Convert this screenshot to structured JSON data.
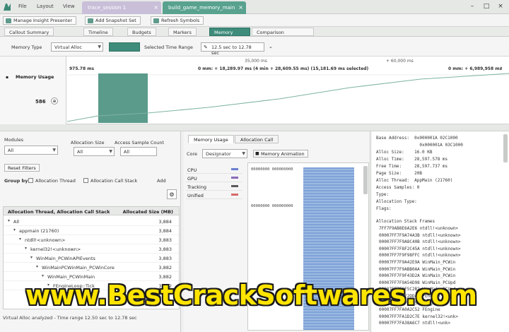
{
  "titlebar": {
    "menu": [
      "File",
      "Layout",
      "View"
    ],
    "tabs": [
      {
        "label": "trace_session 1",
        "active": false
      },
      {
        "label": "build_game_memory_main",
        "active": true
      }
    ]
  },
  "toolbar": {
    "buttons": [
      "Manage Insight Presenter",
      "Add Snapshot Set",
      "Refresh Symbols"
    ]
  },
  "view_tabs": [
    "Callout Summary",
    "Timeline",
    "Budgets",
    "Markers",
    "Memory",
    "Comparison"
  ],
  "filterbar": {
    "memory_type_label": "Memory Type",
    "memory_type_value": "Virtual Alloc",
    "selected_range_label": "Selected Time Range",
    "selected_range_value": "12.5 sec to 12.78 sec"
  },
  "timeline": {
    "track_label": "Memory Usage",
    "ruler_left": "975.78 ms",
    "ruler_mid": "35,000 ms",
    "ruler_right": "+ 60,000 ms",
    "summary_a": "0 mm: + 18,289.97 ms (4 min + 28,609.55 ms) (15,181.69 ms selected)",
    "summary_b": "0 mm: + 6,989,958 ms",
    "y_value": "586"
  },
  "left": {
    "module_label": "Modules",
    "module_value": "All",
    "callstack_label": "Allocation Size",
    "callstack_value": "All",
    "sample_label": "Access Sample Count",
    "sample_value": "All",
    "reset_label": "Reset Filters",
    "options": [
      "Allocation Thread",
      "Allocation Call Stack",
      "Add"
    ],
    "grouping_label": "Group by",
    "tree_header_left": "Allocation Thread, Allocation Call Stack",
    "tree_header_right": "Allocated Size (MB)",
    "rows": [
      {
        "label": "All",
        "value": "3,884",
        "indent": 0
      },
      {
        "label": "appmain (21760)",
        "value": "3,884",
        "indent": 1
      },
      {
        "label": "ntdll!<unknown>",
        "value": "3,883",
        "indent": 2
      },
      {
        "label": "kernel32!<unknown>",
        "value": "3,883",
        "indent": 3
      },
      {
        "label": "WinMain_PCWinAPIEvents",
        "value": "3,883",
        "indent": 4
      },
      {
        "label": "WinMainPCWinMain_PCWinCore",
        "value": "3,882",
        "indent": 5
      },
      {
        "label": "WinMain_PCWinMain",
        "value": "3,882",
        "indent": 6
      },
      {
        "label": "FEngineLoop::Tick",
        "value": "3,882",
        "indent": 7
      }
    ],
    "status": "Virtual Alloc analyzed - Time range 12.50 sec to 12.78 sec"
  },
  "middle": {
    "tabs": [
      "Memory Usage",
      "Allocation Call"
    ],
    "core_label": "Core",
    "core_value": "Designator",
    "animation_label": "Memory Animation",
    "legend": [
      {
        "label": "CPU",
        "color": "#6a7fd1"
      },
      {
        "label": "GPU",
        "color": "#8a6ab8"
      },
      {
        "label": "Tracking",
        "color": "#5a5a5a"
      },
      {
        "label": "Unified",
        "color": "#d56a6a"
      }
    ],
    "addr_a": "00000000 000000000",
    "addr_b": "00000000 000000000"
  },
  "right": {
    "info": [
      "Base Address:  0x000001A 02C1000",
      "                 0x000001A 03C1000",
      "Alloc Size:    16.0 KB",
      "Alloc Time:    28,597.578 ms",
      "Free Time:     28,597.737 ms",
      "Page Size:     20B",
      "Alloc Thread:  AppMain (21760)",
      "Access Samples: 0",
      "Type:",
      "Allocation Type:",
      "Flags:"
    ],
    "stack_title": "Allocation Stack Frames",
    "stack": [
      "7FF7F9AB8E6A2E6 ntdll!<unknown>",
      "00007FF7F9A74A3B ntdll!<unknown>",
      "00007FF7F9A8C40B ntdll!<unknown>",
      "00007FF7F8F2C45A ntdll!<unknown>",
      "00007FF7F9F98FFC ntdll!<unknown>",
      "00007FF7F9A42E9A WinMain_PCWin",
      "00007FF7F9ABB0AA WinMain_PCWin",
      "00007FF7F9F43D2A WinMain_PCWin",
      "00007FF7F9A54D98 WinMain_PCUpd",
      "00007FF7F9F5C2B2 WinMain_PCUpd",
      "00007FF7F9F2DD42 FEngine",
      "00007FF7F9FC3B52 FEngine",
      "00007FF7FA0A2C52 FEngine",
      "00007FF7FA1D2C7E kernel32!<unk>",
      "00007FF7FA38A6C7 ntdll!<unk>"
    ]
  },
  "watermark": "www.BestCrackSoftwares.com"
}
